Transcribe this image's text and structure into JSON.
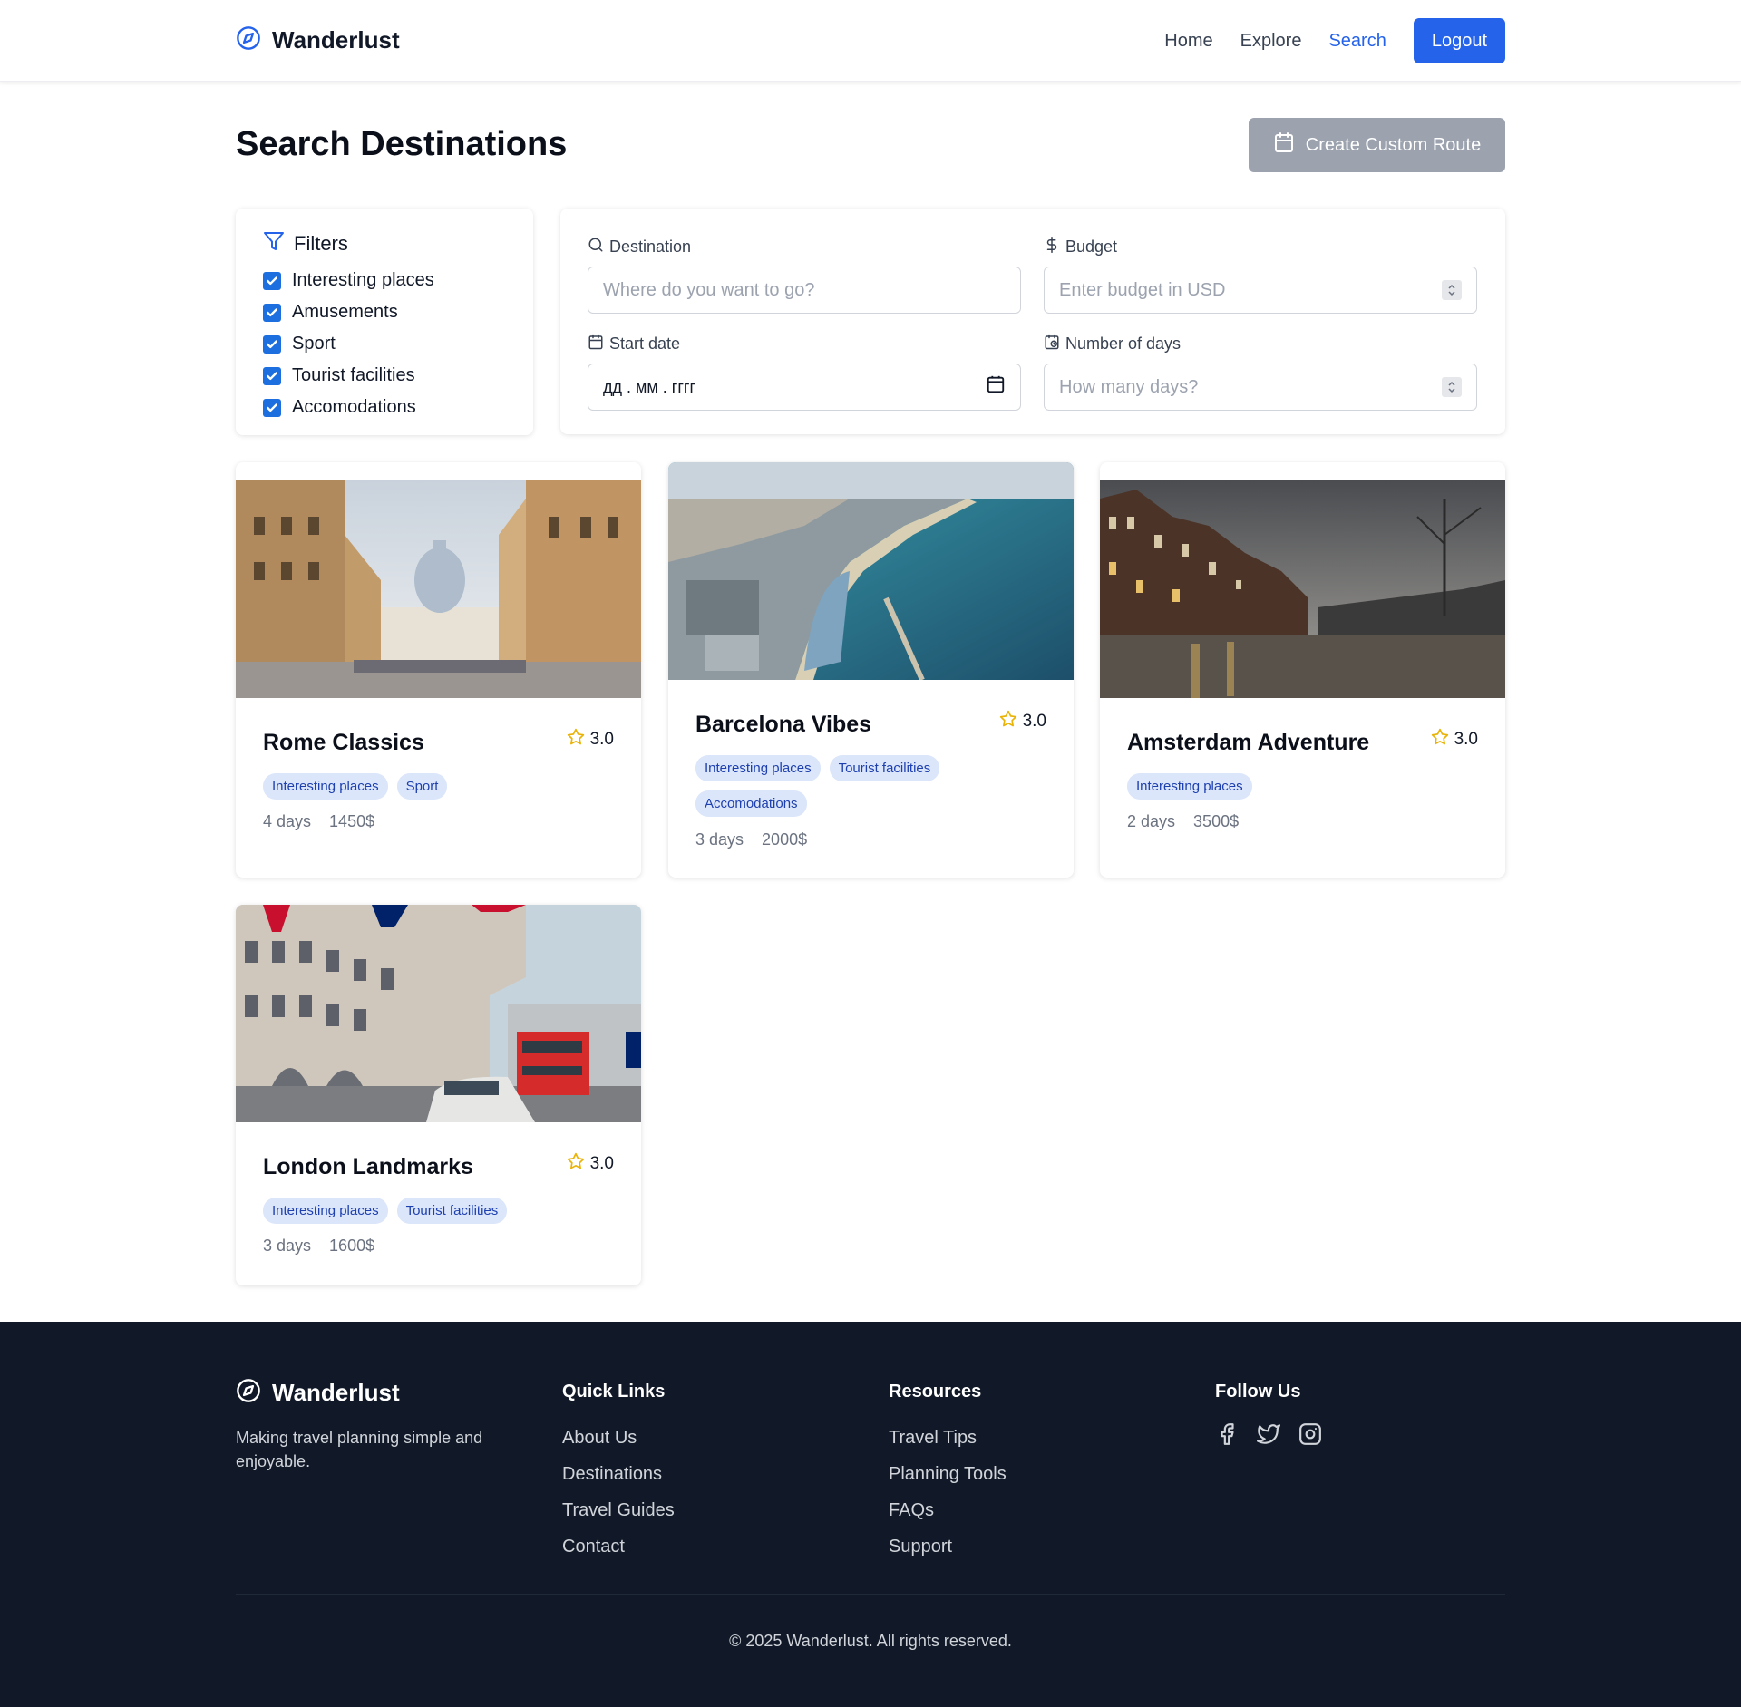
{
  "header": {
    "brand": "Wanderlust",
    "nav": [
      "Home",
      "Explore",
      "Search"
    ],
    "logout": "Logout"
  },
  "page": {
    "title": "Search Destinations",
    "create_button": "Create Custom Route"
  },
  "filters": {
    "title": "Filters",
    "items": [
      {
        "label": "Interesting places",
        "checked": true
      },
      {
        "label": "Amusements",
        "checked": true
      },
      {
        "label": "Sport",
        "checked": true
      },
      {
        "label": "Tourist facilities",
        "checked": true
      },
      {
        "label": "Accomodations",
        "checked": true
      }
    ]
  },
  "search": {
    "destination": {
      "label": "Destination",
      "placeholder": "Where do you want to go?"
    },
    "budget": {
      "label": "Budget",
      "placeholder": "Enter budget in USD"
    },
    "start_date": {
      "label": "Start date",
      "value": "дд . мм . гггг"
    },
    "days": {
      "label": "Number of days",
      "placeholder": "How many days?"
    }
  },
  "cards": [
    {
      "title": "Rome Classics",
      "rating": "3.0",
      "tags": [
        "Interesting places",
        "Sport"
      ],
      "days": "4 days",
      "price": "1450$"
    },
    {
      "title": "Barcelona Vibes",
      "rating": "3.0",
      "tags": [
        "Interesting places",
        "Tourist facilities",
        "Accomodations"
      ],
      "days": "3 days",
      "price": "2000$"
    },
    {
      "title": "Amsterdam Adventure",
      "rating": "3.0",
      "tags": [
        "Interesting places"
      ],
      "days": "2 days",
      "price": "3500$"
    },
    {
      "title": "London Landmarks",
      "rating": "3.0",
      "tags": [
        "Interesting places",
        "Tourist facilities"
      ],
      "days": "3 days",
      "price": "1600$"
    }
  ],
  "footer": {
    "brand": "Wanderlust",
    "description": "Making travel planning simple and enjoyable.",
    "quick_links": {
      "title": "Quick Links",
      "items": [
        "About Us",
        "Destinations",
        "Travel Guides",
        "Contact"
      ]
    },
    "resources": {
      "title": "Resources",
      "items": [
        "Travel Tips",
        "Planning Tools",
        "FAQs",
        "Support"
      ]
    },
    "follow": {
      "title": "Follow Us"
    },
    "copyright": "© 2025 Wanderlust. All rights reserved."
  },
  "colors": {
    "accent": "#2563eb",
    "footer_bg": "#111827",
    "star": "#eab308",
    "tag_bg": "#dbe6fb"
  }
}
